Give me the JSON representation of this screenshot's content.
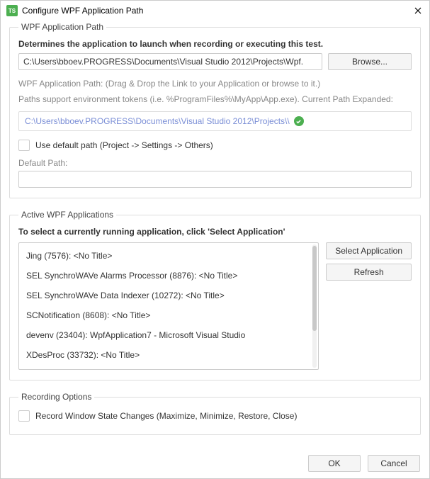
{
  "window": {
    "title": "Configure WPF Application Path"
  },
  "wpf_path": {
    "legend": "WPF Application Path",
    "description": "Determines the application to launch when recording or executing this test.",
    "path_value": "C:\\Users\\bboev.PROGRESS\\Documents\\Visual Studio 2012\\Projects\\Wpf.",
    "browse_label": "Browse...",
    "hint1": "WPF Application Path: (Drag & Drop the Link to your Application or browse to it.)",
    "hint2": "Paths support environment tokens (i.e. %ProgramFiles%\\MyApp\\App.exe). Current Path Expanded:",
    "expanded_path": "C:\\Users\\bboev.PROGRESS\\Documents\\Visual Studio 2012\\Projects\\\\",
    "use_default_label": "Use default path (Project -> Settings -> Others)",
    "default_path_label": "Default Path:",
    "default_path_value": ""
  },
  "active_apps": {
    "legend": "Active WPF Applications",
    "instruction": "To select a currently running application, click 'Select Application'",
    "select_label": "Select Application",
    "refresh_label": "Refresh",
    "items": [
      "Jing (7576): <No Title>",
      "SEL SynchroWAVe Alarms Processor (8876): <No Title>",
      "SEL SynchroWAVe Data Indexer (10272): <No Title>",
      "SCNotification (8608): <No Title>",
      "devenv (23404): WpfApplication7 - Microsoft Visual Studio",
      "XDesProc (33732): <No Title>"
    ]
  },
  "recording": {
    "legend": "Recording Options",
    "record_state_label": "Record Window State Changes (Maximize, Minimize, Restore, Close)"
  },
  "footer": {
    "ok": "OK",
    "cancel": "Cancel"
  }
}
